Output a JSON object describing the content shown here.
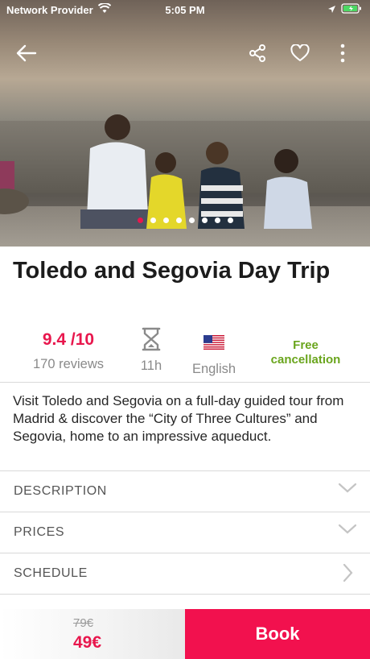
{
  "status_bar": {
    "carrier": "Network Provider",
    "time": "5:05 PM"
  },
  "hero": {
    "slide_count": 8,
    "active_slide": 0,
    "icons": [
      "back-arrow-icon",
      "share-icon",
      "heart-icon",
      "more-vertical-icon"
    ]
  },
  "tour": {
    "title": "Toledo and Segovia Day Trip",
    "rating": "9.4 /10",
    "reviews": "170 reviews",
    "duration": "11h",
    "language": "English",
    "cancellation": "Free cancellation",
    "summary": "Visit Toledo and Segovia on a full-day guided tour from Madrid & discover the “City of Three Cultures” and Segovia, home to an impressive aqueduct."
  },
  "sections": {
    "description": "DESCRIPTION",
    "prices": "PRICES",
    "schedule": "SCHEDULE"
  },
  "booking": {
    "old_price": "79€",
    "price": "49€",
    "book_label": "Book"
  },
  "colors": {
    "accent": "#e8174d",
    "book_button": "#f2114e",
    "cancellation_green": "#6aa51d"
  }
}
